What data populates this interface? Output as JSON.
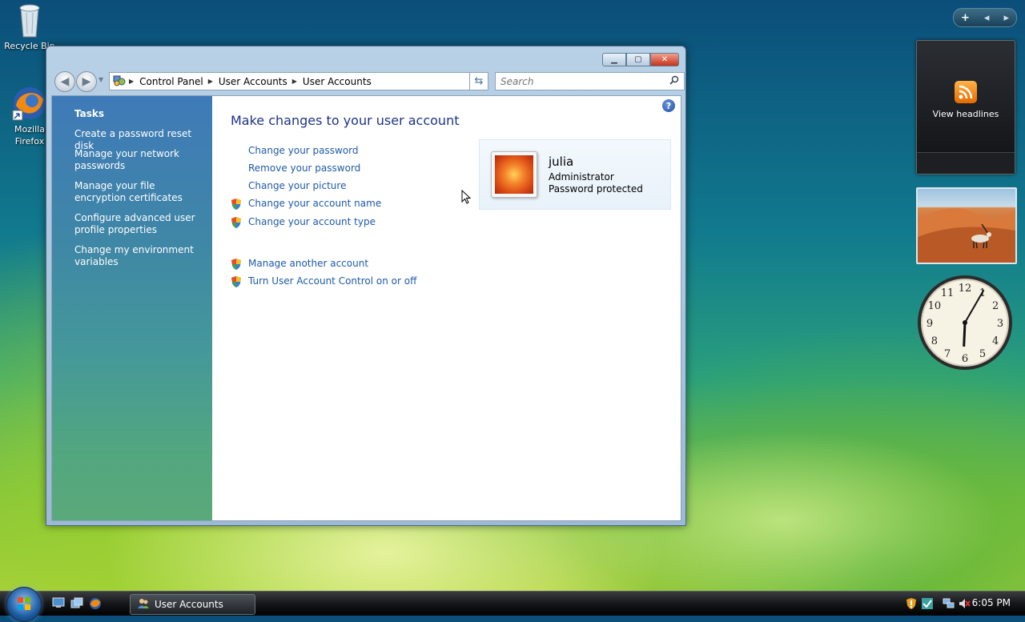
{
  "desktop": {
    "icons": [
      {
        "label": "Recycle Bin",
        "icon": "recycle-bin-icon"
      },
      {
        "label": "Mozilla Firefox",
        "icon": "firefox-icon"
      }
    ]
  },
  "gadgets": {
    "toolbar": {
      "add_glyph": "+",
      "prev_glyph": "◂",
      "next_glyph": "▸"
    },
    "feed": {
      "label": "View headlines",
      "icon": "rss-icon"
    },
    "clock": {
      "numbers": [
        "12",
        "1",
        "2",
        "3",
        "4",
        "5",
        "6",
        "7",
        "8",
        "9",
        "10",
        "11"
      ],
      "time": "6:05"
    }
  },
  "window": {
    "title": "User Accounts",
    "breadcrumb": [
      "Control Panel",
      "User Accounts",
      "User Accounts"
    ],
    "search_placeholder": "Search",
    "help_glyph": "?",
    "tasks": {
      "heading": "Tasks",
      "items": [
        "Create a password reset disk",
        "Manage your network passwords",
        "Manage your file encryption certificates",
        "Configure advanced user profile properties",
        "Change my environment variables"
      ]
    },
    "main": {
      "title": "Make changes to your user account",
      "links": [
        "Change your password",
        "Remove your password",
        "Change your picture",
        "Change your account name",
        "Change your account type"
      ],
      "admin_links": [
        "Manage another account",
        "Turn User Account Control on or off"
      ]
    },
    "user": {
      "name": "julia",
      "role": "Administrator",
      "status": "Password protected"
    }
  },
  "taskbar": {
    "active_window": "User Accounts",
    "time": "6:05 PM"
  },
  "colors": {
    "link": "#1e5aa8",
    "title": "#1e3287"
  }
}
